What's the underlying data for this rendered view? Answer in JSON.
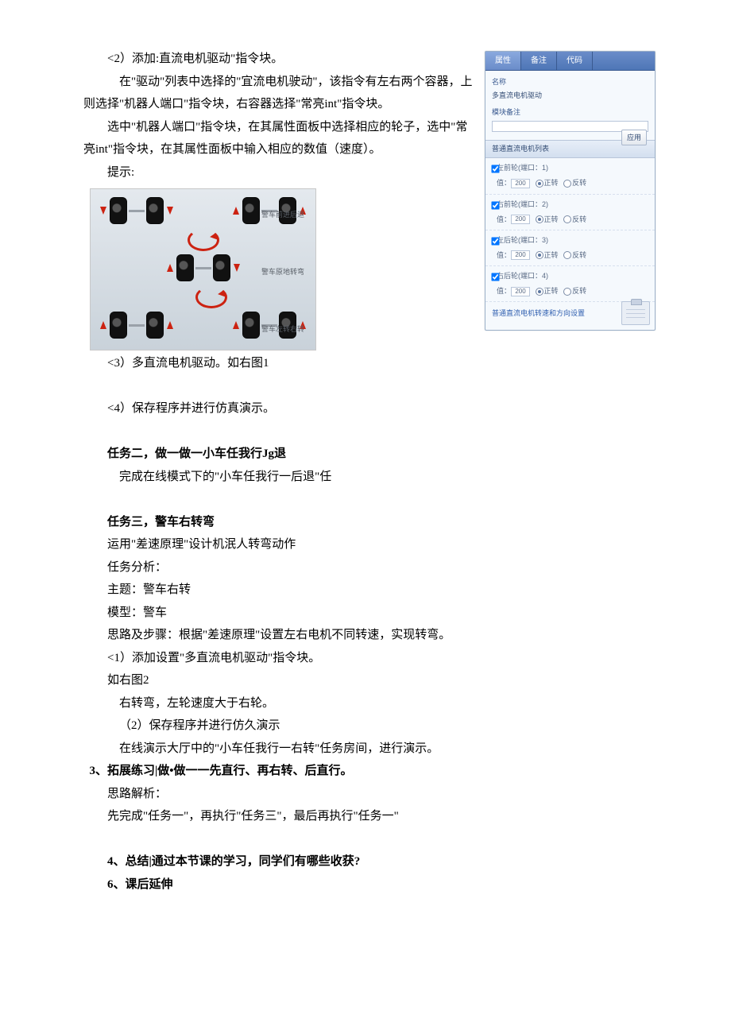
{
  "p1": "<2）添加:直流电机驱动\"指令块。",
  "p2": "在\"驱动\"列表中选择的\"宜流电机驶动\"，该指令有左右两个容器，上则选择\"机器人端口\"指令块，右容器选择\"常亮int\"指令块。",
  "p3": "选中\"机器人端口\"指令块，在其属性面板中选择相应的轮子，选中\"常亮int\"指令块，在其属性面板中输入相应的数值（速度）。",
  "p4": "提示:",
  "p5": "<3）多直流电机驱动。如右图1",
  "p6": "<4）保存程序并进行仿真演示。",
  "task2_title": "任务二，做一做一小车任我行Jg退",
  "task2_body": "完成在线模式下的\"小车任我行一后退\"任",
  "task3_title": "任务三，警车右转弯",
  "t3_l1": "运用\"差速原理\"设计机泯人转弯动作",
  "t3_l2": "任务分析：",
  "t3_l3": "主题：警车右转",
  "t3_l4": "模型：警车",
  "t3_l5": "思路及步骤：根据\"差速原理\"设置左右电机不同转速，实现转弯。",
  "t3_l6": "<1）添加设置\"多直流电机驱动\"指令块。",
  "t3_l7": "如右图2",
  "t3_l8": "右转弯，左轮速度大于右轮。",
  "t3_l9": "（2）保存程序并进行仿久演示",
  "t3_l10": "在线演示大厅中的\"小车任我行一右转\"任务房间，进行演示。",
  "ext_title": "3、拓展练习|做•做一一先直行、再右转、后直行。",
  "ext_l1": "思路解析：",
  "ext_l2": "先完成\"任务一\"，再执行\"任务三\"，最后再执行\"任务一\"",
  "sum_title": "4、总结|通过本节课的学习，同学们有哪些收获?",
  "after_title": "6、课后延伸",
  "panel": {
    "tabs": [
      "属性",
      "备注",
      "代码"
    ],
    "name_label": "名称",
    "name_value": "多直流电机驱动",
    "remark_label": "模块备注",
    "list_head": "普通直流电机列表",
    "apply": "应用",
    "footer": "普通直流电机转速和方向设置",
    "motors": [
      {
        "label": "左前轮(端口：1)",
        "val": "200",
        "fwd": "正转",
        "rev": "反转"
      },
      {
        "label": "右前轮(端口：2)",
        "val": "200",
        "fwd": "正转",
        "rev": "反转"
      },
      {
        "label": "左后轮(端口：3)",
        "val": "200",
        "fwd": "正转",
        "rev": "反转"
      },
      {
        "label": "右后轮(端口：4)",
        "val": "200",
        "fwd": "正转",
        "rev": "反转"
      }
    ],
    "value_prefix": "值："
  },
  "wheels": {
    "cap1": "警车前进后退",
    "cap2": "警车原地转弯",
    "cap3": "警车左转右转"
  }
}
